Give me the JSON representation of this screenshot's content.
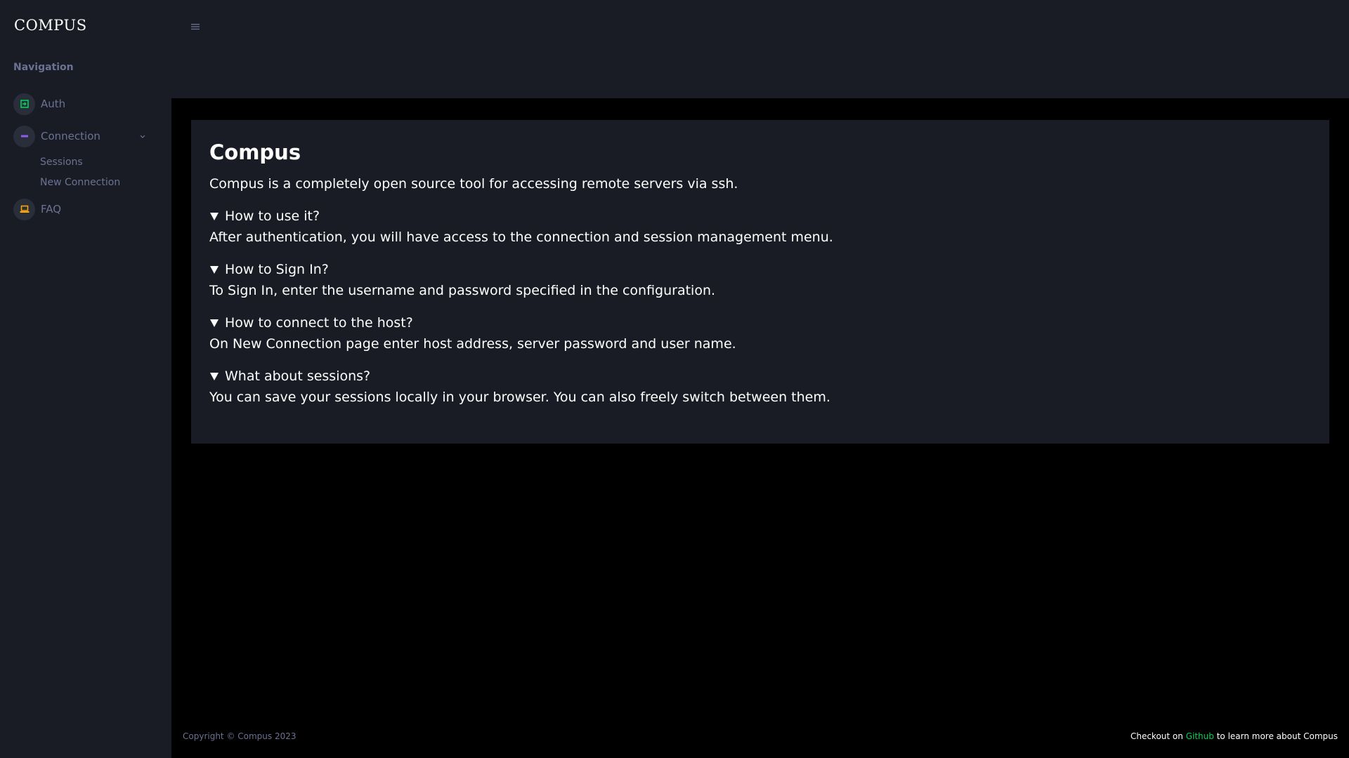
{
  "sidebar": {
    "brand": "COMPUS",
    "heading": "Navigation",
    "items": [
      {
        "label": "Auth",
        "icon": "login-icon",
        "icon_color": "#00d25b"
      },
      {
        "label": "Connection",
        "icon": "minus-icon",
        "icon_color": "#8f5fe8"
      },
      {
        "label": "FAQ",
        "icon": "laptop-icon",
        "icon_color": "#ffab00"
      }
    ],
    "sub_items": [
      "Sessions",
      "New Connection"
    ]
  },
  "main": {
    "title": "Compus",
    "intro": "Compus is a completely open source tool for accessing remote servers via ssh.",
    "faqs": [
      {
        "q": "How to use it?",
        "a": "After authentication, you will have access to the connection and session management menu."
      },
      {
        "q": "How to Sign In?",
        "a": "To Sign In, enter the username and password specified in the configuration."
      },
      {
        "q": "How to connect to the host?",
        "a": "On New Connection page enter host address, server password and user name."
      },
      {
        "q": "What about sessions?",
        "a": "You can save your sessions locally in your browser. You can also freely switch between them."
      }
    ]
  },
  "footer": {
    "copyright": "Copyright © Compus 2023",
    "right_prefix": "Checkout on",
    "link": "Github",
    "right_suffix": "to learn more about Compus"
  },
  "colors": {
    "background": "#000000",
    "panel": "#191c24",
    "muted": "#6c7293",
    "accent_green": "#00d25b"
  }
}
